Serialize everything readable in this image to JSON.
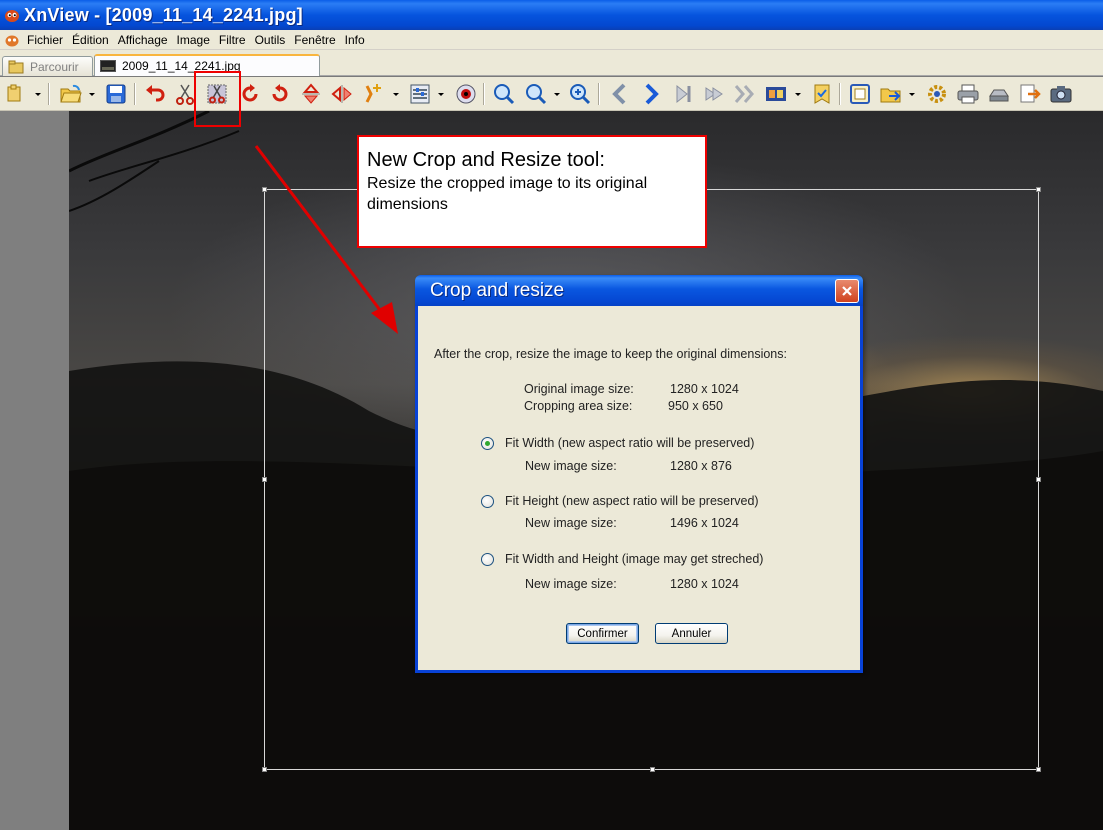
{
  "window": {
    "title": "XnView - [2009_11_14_2241.jpg]"
  },
  "menu": [
    "Fichier",
    "Édition",
    "Affichage",
    "Image",
    "Filtre",
    "Outils",
    "Fenêtre",
    "Info"
  ],
  "tabs": [
    {
      "label": "Parcourir",
      "active": false
    },
    {
      "label": "2009_11_14_2241.jpg",
      "active": true
    }
  ],
  "toolbar_icons": [
    "browser-icon",
    "open-folder-icon",
    "save-icon",
    "undo-icon",
    "cut-icon",
    "crop-resize-icon",
    "rotate-left-icon",
    "rotate-right-icon",
    "flip-vertical-icon",
    "flip-horizontal-icon",
    "resize-icon",
    "adjust-icon",
    "red-eye-icon",
    "zoom-in-icon",
    "zoom-out-icon",
    "zoom-fit-icon",
    "previous-icon",
    "next-icon",
    "first-icon",
    "last-icon",
    "slideshow-icon",
    "filmstrip-icon",
    "bookmark-icon",
    "copy-icon",
    "move-icon",
    "settings-icon",
    "print-icon",
    "scanner-icon",
    "export-icon",
    "camera-icon"
  ],
  "callout": {
    "title": "New Crop and Resize tool:",
    "body": "Resize the cropped image to its original dimensions"
  },
  "dialog": {
    "title": "Crop and resize",
    "intro": "After the crop, resize the image to keep the original dimensions:",
    "original_label": "Original image size:",
    "original_value": "1280 x 1024",
    "crop_label": "Cropping area size:",
    "crop_value": "950 x 650",
    "options": [
      {
        "label": "Fit Width (new aspect ratio will be preserved)",
        "size_label": "New image size:",
        "size_value": "1280 x 876",
        "checked": true
      },
      {
        "label": "Fit Height (new aspect ratio will be preserved)",
        "size_label": "New image size:",
        "size_value": "1496 x 1024",
        "checked": false
      },
      {
        "label": "Fit Width and Height (image may get streched)",
        "size_label": "New image size:",
        "size_value": "1280 x 1024",
        "checked": false
      }
    ],
    "confirm_label": "Confirmer",
    "cancel_label": "Annuler"
  },
  "colors": {
    "title_blue": "#0654de",
    "annotation_red": "#e00000",
    "dialog_bg": "#ece9d8"
  }
}
